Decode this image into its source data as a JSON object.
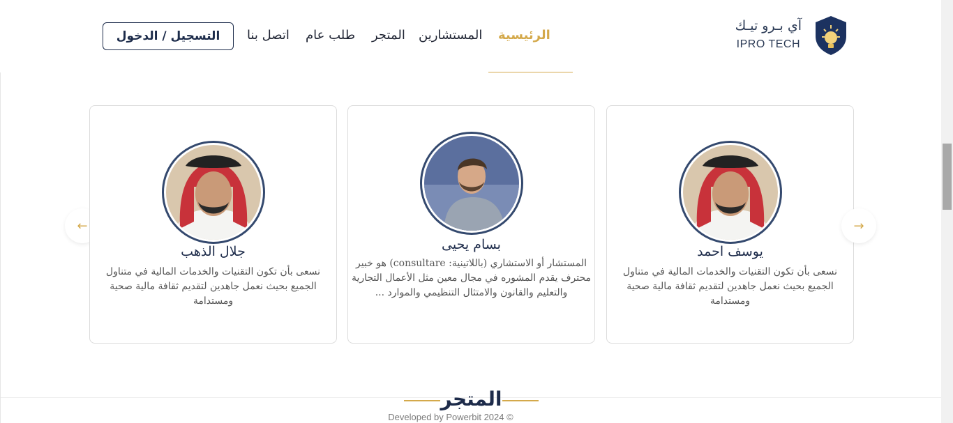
{
  "header": {
    "brand_ar": "آي بـرو تيـك",
    "brand_en": "IPRO TECH",
    "nav": {
      "home": "الرئيسية",
      "consultants": "المستشارين",
      "store": "المتجر",
      "general_request": "طلب عام",
      "contact": "اتصل بنا"
    },
    "login_label": "التسجيل / الدخول"
  },
  "consultants": [
    {
      "name": "يوسف احمد",
      "description": "نسعى بأن تكون التقنيات والخدمات المالية في متناول الجميع بحيث نعمل جاهدين لتقديم ثقافة مالية صحية ومستدامة"
    },
    {
      "name": "بسام يحيى",
      "description": "المستشار أو الاستشاري (باللاتينية: consultare) هو خبير محترف يقدم المشوره في مجال معين مثل الأعمال التجارية والتعليم والقانون والامتثال التنظيمي والموارد ..."
    },
    {
      "name": "جلال الذهب",
      "description": "نسعى بأن تكون التقنيات والخدمات المالية في متناول الجميع بحيث نعمل جاهدين لتقديم ثقافة مالية صحية ومستدامة"
    }
  ],
  "carousel": {
    "prev_icon": "arrow-left-icon",
    "next_icon": "arrow-right-icon"
  },
  "store_section": {
    "title": "المتجر"
  },
  "footer": {
    "text": "Developed by Powerbit 2024 ©"
  },
  "colors": {
    "accent": "#d4a94b",
    "navy": "#1d2b4a",
    "avatar_border": "#34496e"
  }
}
